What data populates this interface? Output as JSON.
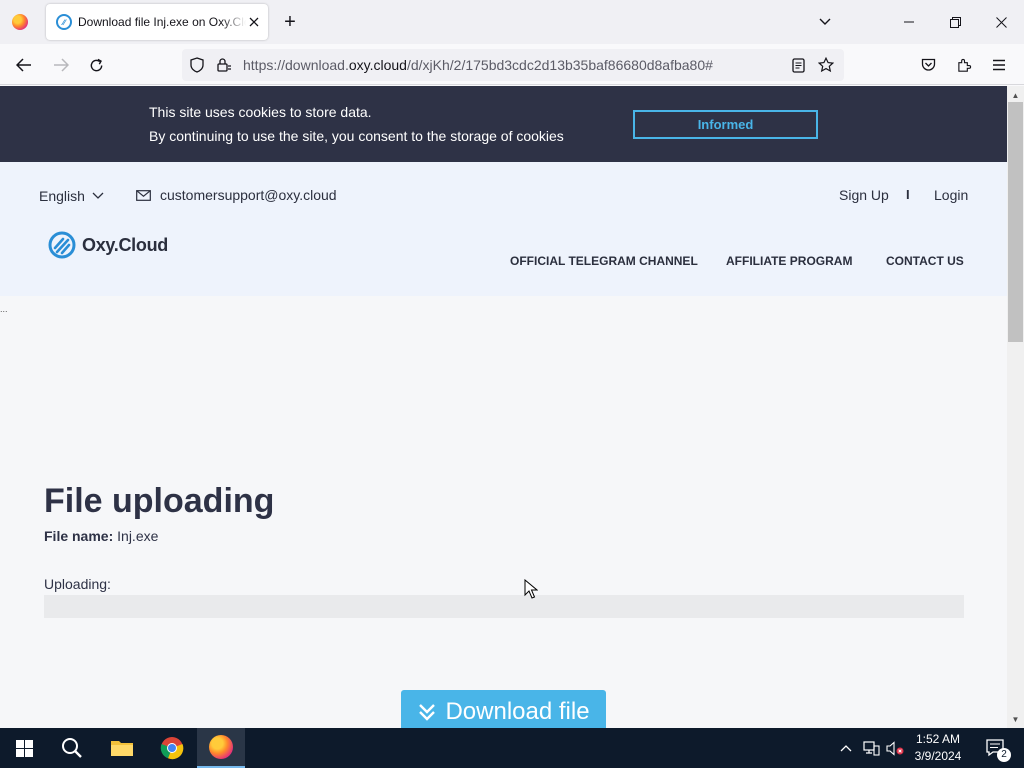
{
  "browser": {
    "tab_title": "Download file Inj.exe on Oxy.Cloud",
    "url_prefix": "https://download.",
    "url_host": "oxy.cloud",
    "url_path": "/d/xjKh/2/175bd3cdc2d13b35baf86680d8afba80#"
  },
  "cookie": {
    "line1": "This site uses cookies to store data.",
    "line2": "By continuing to use the site, you consent to the storage of cookies",
    "button": "Informed"
  },
  "header": {
    "language": "English",
    "email": "customersupport@oxy.cloud",
    "signup": "Sign Up",
    "separator": "I",
    "login": "Login",
    "logo_text": "Oxy.Cloud",
    "nav": [
      "OFFICIAL TELEGRAM CHANNEL",
      "AFFILIATE PROGRAM",
      "CONTACT US"
    ]
  },
  "main": {
    "title": "File uploading",
    "file_name_label": "File name:",
    "file_name": "Inj.exe",
    "uploading_label": "Uploading:",
    "progress": 0,
    "download_button": "Download file",
    "dots": "..."
  },
  "colors": {
    "accent": "#49b5e8",
    "dark": "#2e3246",
    "header_bg": "#eef3fc"
  },
  "taskbar": {
    "time": "1:52 AM",
    "date": "3/9/2024",
    "notification_count": "2"
  }
}
